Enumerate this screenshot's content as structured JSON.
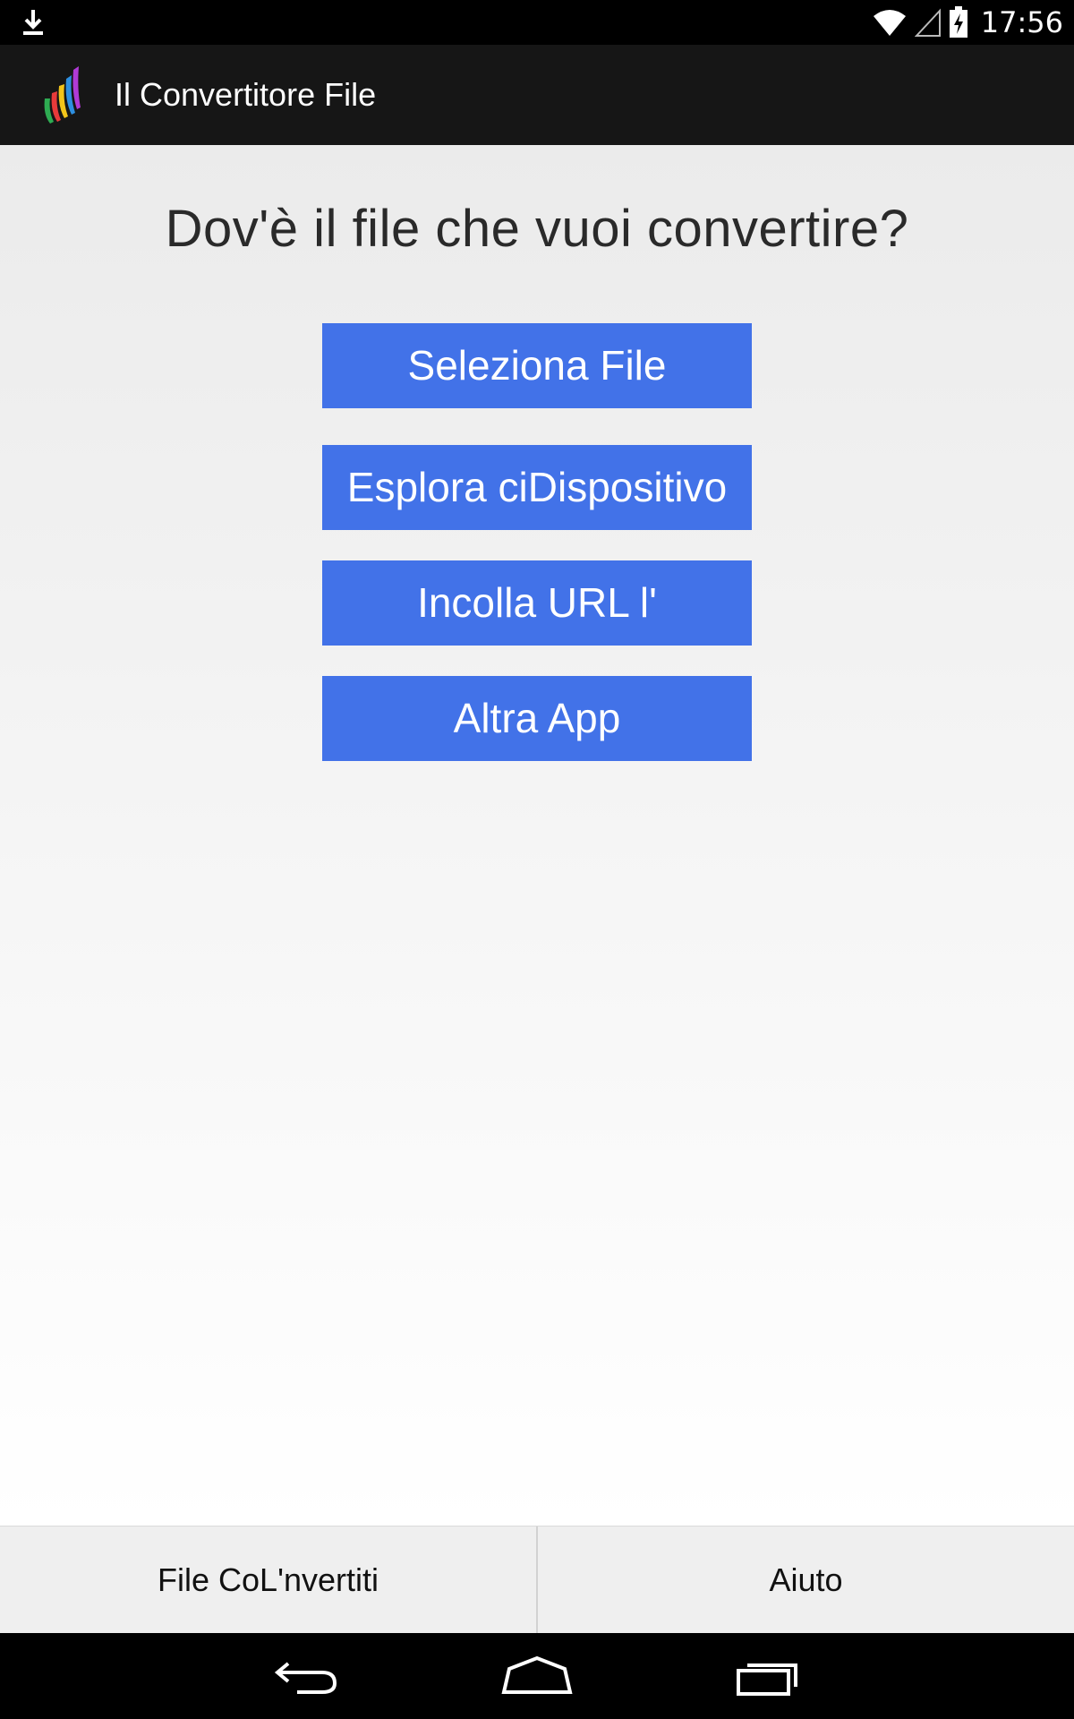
{
  "status_bar": {
    "time": "17:56",
    "icons": [
      "download-icon",
      "wifi-icon",
      "signal-icon",
      "battery-charging-icon"
    ]
  },
  "action_bar": {
    "title": "Il Convertitore File",
    "icon": "app-logo-icon"
  },
  "main": {
    "question": "Dov'è il file che vuoi convertire?",
    "buttons": [
      {
        "label": "Seleziona File"
      },
      {
        "label": "Esplora ciDispositivo"
      },
      {
        "label": "Incolla URL l'"
      },
      {
        "label": "Altra App"
      }
    ],
    "button_color": "#4272e8"
  },
  "bottom_tabs": [
    {
      "label": "File CoL'nvertiti"
    },
    {
      "label": "Aiuto"
    }
  ],
  "nav_bar": {
    "icons": [
      "back-icon",
      "home-icon",
      "recents-icon"
    ]
  }
}
